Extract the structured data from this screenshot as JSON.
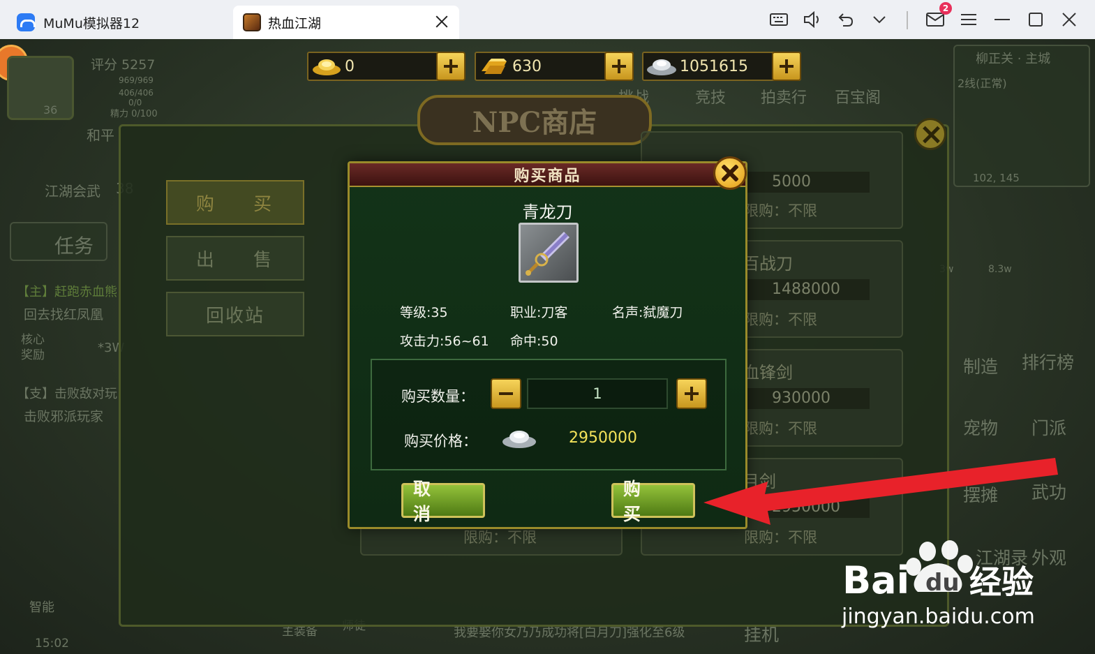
{
  "emulator": {
    "app_tab_label": "MuMu模拟器12",
    "game_tab_label": "热血江湖",
    "mail_badge": "2"
  },
  "currency": {
    "gold": "0",
    "yuanbao": "630",
    "silver": "1051615"
  },
  "background": {
    "score": "评分 5257",
    "level": "36",
    "hp": "969/969",
    "mp": "406/406",
    "misc": "0/0",
    "stamina": "精力 0/100",
    "mode": "和平",
    "martial": "江湖会武",
    "martial_num": "38",
    "task_label": "任务",
    "quest1_title": "【主】赶跑赤血熊",
    "quest1_desc": "回去找红凤凰",
    "quest1_reward_label": "核心奖励",
    "quest1_reward_amount": "*3W",
    "quest2_title": "【支】击败敌对玩",
    "quest2_desc": "击败邪派玩家",
    "map_title": "柳正关 · 主城",
    "map_line": "2线(正常)",
    "map_coords": "102, 145",
    "top_menu": [
      "挑战",
      "竞技",
      "拍卖行",
      "百宝阁"
    ],
    "right_menu": [
      "制造",
      "排行榜",
      "宠物",
      "门派",
      "摆摊",
      "武功",
      "江湖录",
      "外观"
    ],
    "right_amounts": [
      "3w",
      "8.3w"
    ],
    "bottom_bar": [
      "主装备",
      "师徒",
      "挂机"
    ],
    "chat": "我要娶你女乃乃成功将[白月刀]强化至6级",
    "time": "15:02",
    "smart": "智能"
  },
  "shop": {
    "title": "NPC商店",
    "tabs": [
      "购 买",
      "出 售",
      "回收站"
    ],
    "items": [
      {
        "name": "",
        "price": "5000",
        "limit": "限购：不限"
      },
      {
        "name": "百战刀",
        "price": "1488000",
        "limit": "限购：不限"
      },
      {
        "name": "血锋剑",
        "price": "930000",
        "limit": "限购：不限"
      },
      {
        "name": "月剑",
        "price": "2950000",
        "limit": "限购：不限"
      }
    ],
    "left_limit": "限购：不限"
  },
  "dialog": {
    "header": "购买商品",
    "item_name": "青龙刀",
    "level": "等级:35",
    "job": "职业:刀客",
    "fame": "名声:弑魔刀",
    "attack": "攻击力:56~61",
    "hit": "命中:50",
    "qty_label": "购买数量：",
    "qty_value": "1",
    "price_label": "购买价格：",
    "price_value": "2950000",
    "cancel_label": "取 消",
    "buy_label": "购 买"
  },
  "watermark": {
    "brand": "Bai",
    "brand2": "du",
    "cn": "经验",
    "url": "jingyan.baidu.com"
  },
  "colors": {
    "dialog_bg": "#133318",
    "dialog_border": "#9a8b2a",
    "gold_button": "#e2b23a",
    "green_button": "#6ea024",
    "price_yellow": "#f3e25a",
    "arrow_red": "#e8222a"
  }
}
